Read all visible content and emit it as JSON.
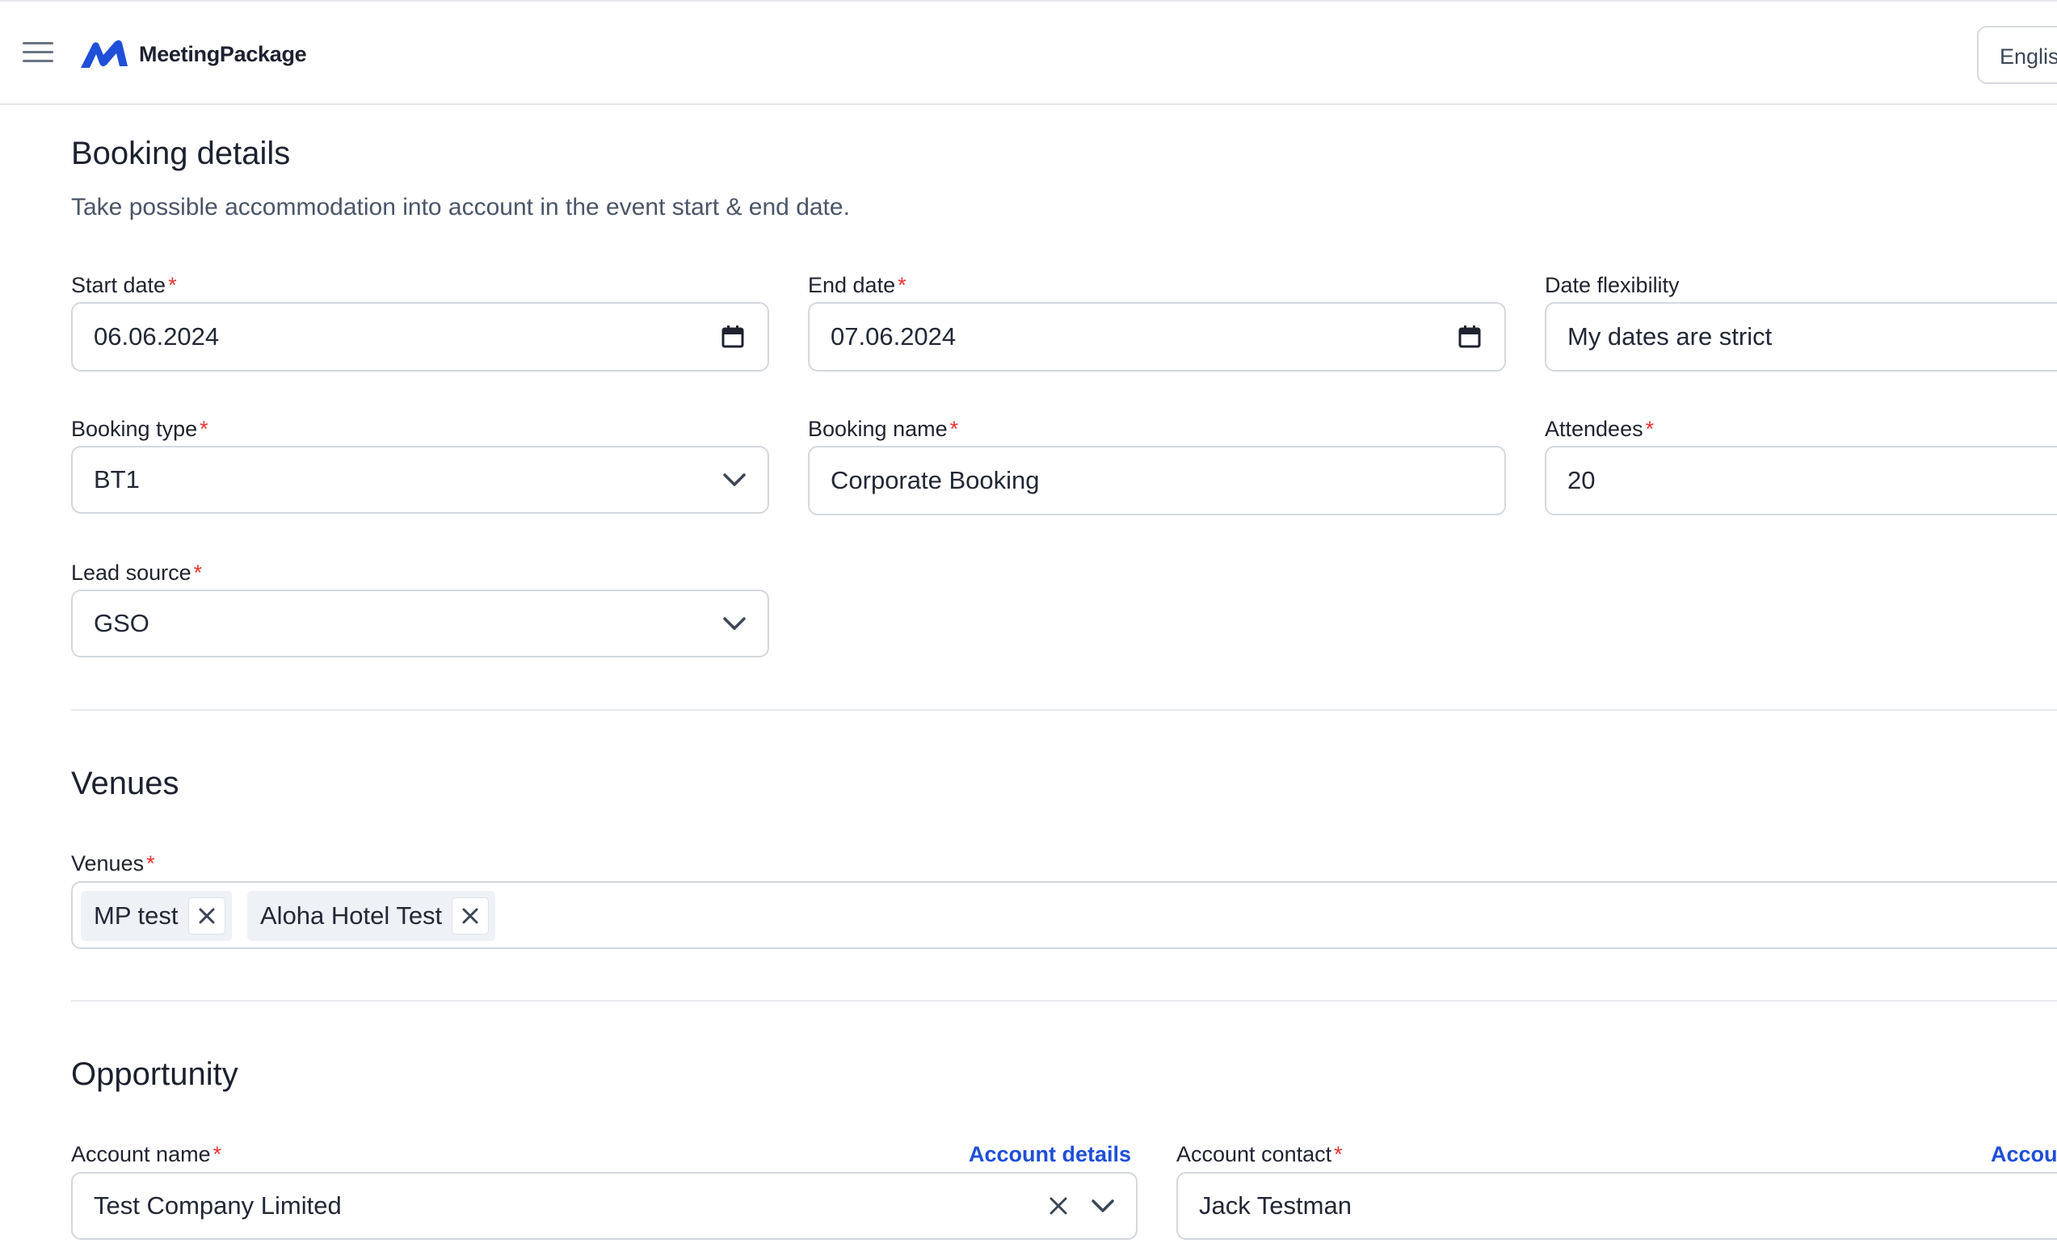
{
  "header": {
    "brand": "MeetingPackage",
    "language": "English"
  },
  "booking": {
    "title": "Booking details",
    "subtitle": "Take possible accommodation into account in the event start & end date.",
    "start_date": {
      "label": "Start date",
      "value": "06.06.2024"
    },
    "end_date": {
      "label": "End date",
      "value": "07.06.2024"
    },
    "date_flexibility": {
      "label": "Date flexibility",
      "value": "My dates are strict"
    },
    "booking_type": {
      "label": "Booking type",
      "value": "BT1"
    },
    "booking_name": {
      "label": "Booking name",
      "value": "Corporate Booking"
    },
    "attendees": {
      "label": "Attendees",
      "value": "20"
    },
    "lead_source": {
      "label": "Lead source",
      "value": "GSO"
    },
    "required_mark": "*"
  },
  "venues": {
    "title": "Venues",
    "label": "Venues",
    "selected": [
      "MP test",
      "Aloha Hotel Test"
    ]
  },
  "opportunity": {
    "title": "Opportunity",
    "account_name": {
      "label": "Account name",
      "value": "Test Company Limited",
      "link": "Account details"
    },
    "account_contact": {
      "label": "Account contact",
      "value": "Jack Testman",
      "link": "Account details"
    }
  },
  "colors": {
    "brand_blue": "#1f4fd8",
    "required_red": "#e3342f",
    "border": "#d3d8de"
  }
}
